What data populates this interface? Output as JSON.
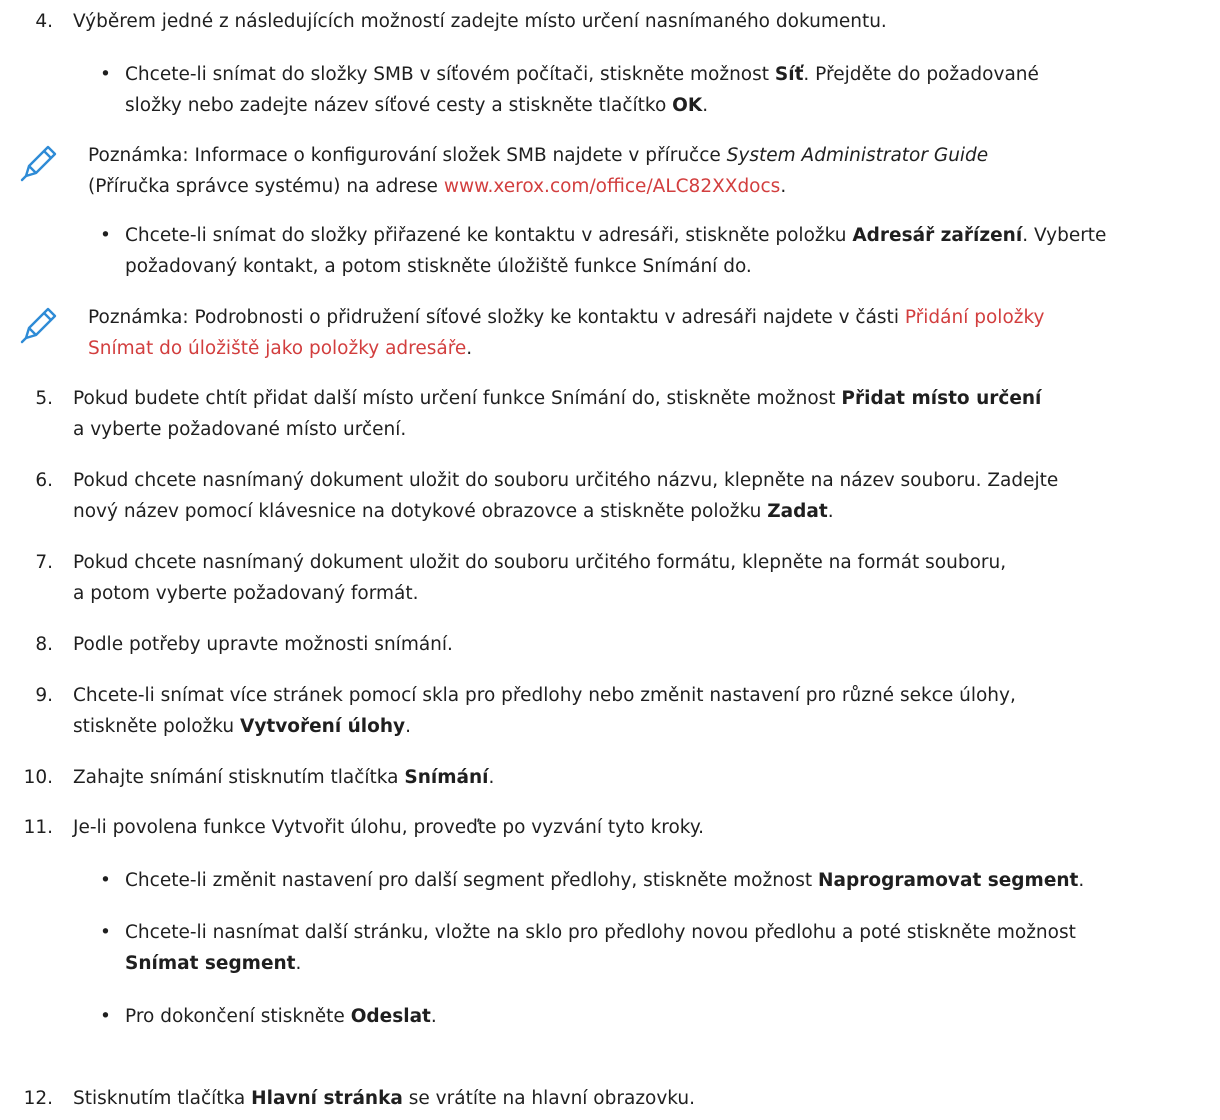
{
  "steps": {
    "s4": {
      "num": "4.",
      "text": "Výběrem jedné z následujících možností zadejte místo určení nasnímaného dokumentu."
    },
    "b4a": {
      "pre": "Chcete-li snímat do složky SMB v síťovém počítači, stiskněte možnost ",
      "bold1": "Síť",
      "mid": ". Přejděte do požadované",
      "line2pre": "složky nebo zadejte název síťové cesty a stiskněte tlačítko ",
      "bold2": "OK",
      "post": "."
    },
    "note1": {
      "pre": "Poznámka: Informace o konfigurování složek SMB najdete v příručce ",
      "italic": "System Administrator Guide",
      "line2pre": "(Příručka správce systému) na adrese ",
      "link": "www.xerox.com/office/ALC82XXdocs",
      "post": "."
    },
    "b4b": {
      "pre": "Chcete-li snímat do složky přiřazené ke kontaktu v adresáři, stiskněte položku ",
      "bold1": "Adresář zařízení",
      "mid": ". Vyberte",
      "line2": "požadovaný kontakt, a potom stiskněte úložiště funkce Snímání do."
    },
    "note2": {
      "pre": "Poznámka: Podrobnosti o přidružení síťové složky ke kontaktu v adresáři najdete v části ",
      "link1": "Přidání položky",
      "link2": "Snímat do úložiště jako položky adresáře",
      "post": "."
    },
    "s5": {
      "num": "5.",
      "pre": "Pokud budete chtít přidat další místo určení funkce Snímání do, stiskněte možnost ",
      "bold": "Přidat místo určení",
      "line2": "a vyberte požadované místo určení."
    },
    "s6": {
      "num": "6.",
      "line1": "Pokud chcete nasnímaný dokument uložit do souboru určitého názvu, klepněte na název souboru. Zadejte",
      "line2pre": "nový název pomocí klávesnice na dotykové obrazovce a stiskněte položku ",
      "bold": "Zadat",
      "post": "."
    },
    "s7": {
      "num": "7.",
      "line1": "Pokud chcete nasnímaný dokument uložit do souboru určitého formátu, klepněte na formát souboru,",
      "line2": "a potom vyberte požadovaný formát."
    },
    "s8": {
      "num": "8.",
      "text": "Podle potřeby upravte možnosti snímání."
    },
    "s9": {
      "num": "9.",
      "line1": "Chcete-li snímat více stránek pomocí skla pro předlohy nebo změnit nastavení pro různé sekce úlohy,",
      "line2pre": "stiskněte položku ",
      "bold": "Vytvoření úlohy",
      "post": "."
    },
    "s10": {
      "num": "10.",
      "pre": "Zahajte snímání stisknutím tlačítka ",
      "bold": "Snímání",
      "post": "."
    },
    "s11": {
      "num": "11.",
      "text": "Je-li povolena funkce Vytvořit úlohu, proveďte po vyzvání tyto kroky."
    },
    "b11a": {
      "pre": "Chcete-li změnit nastavení pro další segment předlohy, stiskněte možnost ",
      "bold": "Naprogramovat segment",
      "post": "."
    },
    "b11b": {
      "line1": "Chcete-li nasnímat další stránku, vložte na sklo pro předlohy novou předlohu a poté stiskněte možnost",
      "bold": "Snímat segment",
      "post": "."
    },
    "b11c": {
      "pre": "Pro dokončení stiskněte ",
      "bold": "Odeslat",
      "post": "."
    },
    "s12": {
      "num": "12.",
      "pre": "Stisknutím tlačítka ",
      "bold": "Hlavní stránka",
      "post": " se vrátíte na hlavní obrazovku."
    }
  },
  "icons": {
    "note": "pencil-icon",
    "bullet": "•"
  },
  "colors": {
    "text": "#1f1f1f",
    "link": "#d23e3e",
    "icon": "#2e8bd6"
  }
}
